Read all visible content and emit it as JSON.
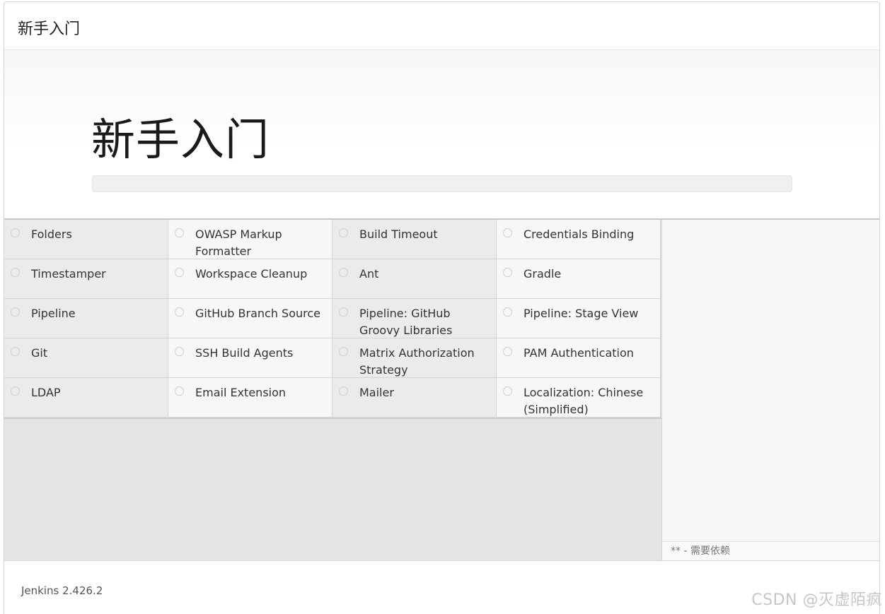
{
  "window": {
    "title": "新手入门"
  },
  "hero": {
    "title": "新手入门",
    "progress_percent": 0
  },
  "plugins": [
    "Folders",
    "OWASP Markup Formatter",
    "Build Timeout",
    "Credentials Binding",
    "Timestamper",
    "Workspace Cleanup",
    "Ant",
    "Gradle",
    "Pipeline",
    "GitHub Branch Source",
    "Pipeline: GitHub Groovy Libraries",
    "Pipeline: Stage View",
    "Git",
    "SSH Build Agents",
    "Matrix Authorization Strategy",
    "PAM Authentication",
    "LDAP",
    "Email Extension",
    "Mailer",
    "Localization: Chinese (Simplified)"
  ],
  "side_panel": {
    "legend": "** - 需要依赖"
  },
  "footer": {
    "version": "Jenkins 2.426.2"
  },
  "watermark": "CSDN @灭虚陌疯"
}
